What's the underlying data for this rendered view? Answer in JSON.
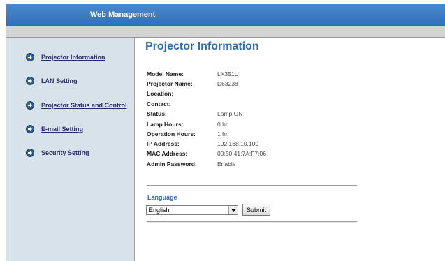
{
  "header": {
    "title": "Web Management"
  },
  "sidebar": {
    "items": [
      {
        "label": "Projector Information"
      },
      {
        "label": "LAN Setting"
      },
      {
        "label": "Projector Status and Control"
      },
      {
        "label": "E-mail Setting"
      },
      {
        "label": "Security Setting"
      }
    ]
  },
  "main": {
    "title": "Projector Information",
    "info": [
      {
        "label": "Model Name:",
        "value": "LX351U"
      },
      {
        "label": "Projector Name:",
        "value": "D63238"
      },
      {
        "label": "Location:",
        "value": ""
      },
      {
        "label": "Contact:",
        "value": ""
      },
      {
        "label": "Status:",
        "value": "Lamp ON"
      },
      {
        "label": "Lamp Hours:",
        "value": "0 hr."
      },
      {
        "label": "Operation Hours:",
        "value": "1 hr."
      },
      {
        "label": "IP Address:",
        "value": "192.168.10.100"
      },
      {
        "label": "MAC Address:",
        "value": "00:50:41:7A:F7:06"
      },
      {
        "label": "Admin Password:",
        "value": "Enable"
      }
    ],
    "language": {
      "label": "Language",
      "selected": "English",
      "submit_label": "Submit"
    }
  }
}
